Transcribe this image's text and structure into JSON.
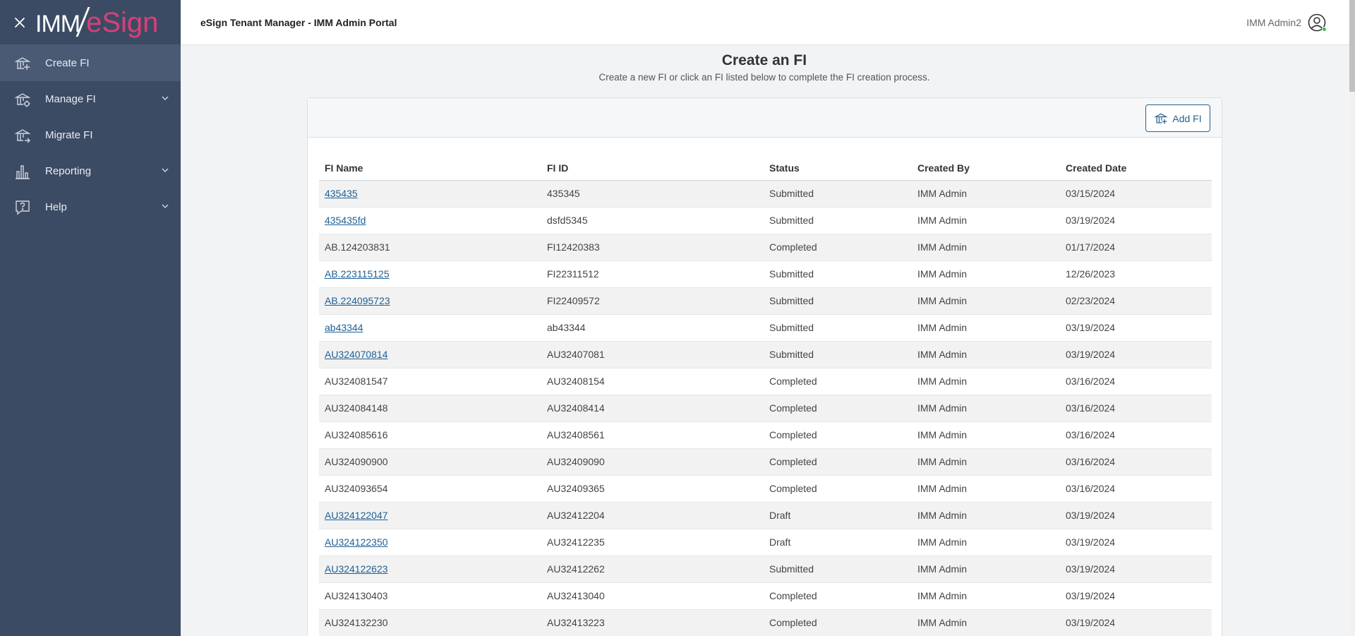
{
  "sidebar": {
    "logo": {
      "left": "IMM",
      "right": "eSign"
    },
    "items": [
      {
        "label": "Create FI",
        "icon": "bank-add-icon",
        "active": true,
        "expandable": false
      },
      {
        "label": "Manage FI",
        "icon": "bank-gear-icon",
        "active": false,
        "expandable": true
      },
      {
        "label": "Migrate FI",
        "icon": "bank-arrow-icon",
        "active": false,
        "expandable": false
      },
      {
        "label": "Reporting",
        "icon": "bar-chart-icon",
        "active": false,
        "expandable": true
      },
      {
        "label": "Help",
        "icon": "help-icon",
        "active": false,
        "expandable": true
      }
    ]
  },
  "topbar": {
    "title": "eSign Tenant Manager - IMM Admin Portal",
    "user_name": "IMM Admin2"
  },
  "main": {
    "title": "Create an FI",
    "subtitle": "Create a new FI or click an FI listed below to complete the FI creation process.",
    "add_button_label": "Add FI"
  },
  "table": {
    "columns": [
      "FI Name",
      "FI ID",
      "Status",
      "Created By",
      "Created Date"
    ],
    "rows": [
      {
        "name": "435435",
        "id": "435345",
        "status": "Submitted",
        "by": "IMM Admin",
        "date": "03/15/2024",
        "link": true
      },
      {
        "name": "435435fd",
        "id": "dsfd5345",
        "status": "Submitted",
        "by": "IMM Admin",
        "date": "03/19/2024",
        "link": true
      },
      {
        "name": "AB.124203831",
        "id": "FI12420383",
        "status": "Completed",
        "by": "IMM Admin",
        "date": "01/17/2024",
        "link": false
      },
      {
        "name": "AB.223115125",
        "id": "FI22311512",
        "status": "Submitted",
        "by": "IMM Admin",
        "date": "12/26/2023",
        "link": true
      },
      {
        "name": "AB.224095723",
        "id": "FI22409572",
        "status": "Submitted",
        "by": "IMM Admin",
        "date": "02/23/2024",
        "link": true
      },
      {
        "name": "ab43344",
        "id": "ab43344",
        "status": "Submitted",
        "by": "IMM Admin",
        "date": "03/19/2024",
        "link": true
      },
      {
        "name": "AU324070814",
        "id": "AU32407081",
        "status": "Submitted",
        "by": "IMM Admin",
        "date": "03/19/2024",
        "link": true
      },
      {
        "name": "AU324081547",
        "id": "AU32408154",
        "status": "Completed",
        "by": "IMM Admin",
        "date": "03/16/2024",
        "link": false
      },
      {
        "name": "AU324084148",
        "id": "AU32408414",
        "status": "Completed",
        "by": "IMM Admin",
        "date": "03/16/2024",
        "link": false
      },
      {
        "name": "AU324085616",
        "id": "AU32408561",
        "status": "Completed",
        "by": "IMM Admin",
        "date": "03/16/2024",
        "link": false
      },
      {
        "name": "AU324090900",
        "id": "AU32409090",
        "status": "Completed",
        "by": "IMM Admin",
        "date": "03/16/2024",
        "link": false
      },
      {
        "name": "AU324093654",
        "id": "AU32409365",
        "status": "Completed",
        "by": "IMM Admin",
        "date": "03/16/2024",
        "link": false
      },
      {
        "name": "AU324122047",
        "id": "AU32412204",
        "status": "Draft",
        "by": "IMM Admin",
        "date": "03/19/2024",
        "link": true
      },
      {
        "name": "AU324122350",
        "id": "AU32412235",
        "status": "Draft",
        "by": "IMM Admin",
        "date": "03/19/2024",
        "link": true
      },
      {
        "name": "AU324122623",
        "id": "AU32412262",
        "status": "Submitted",
        "by": "IMM Admin",
        "date": "03/19/2024",
        "link": true
      },
      {
        "name": "AU324130403",
        "id": "AU32413040",
        "status": "Completed",
        "by": "IMM Admin",
        "date": "03/19/2024",
        "link": false
      },
      {
        "name": "AU324132230",
        "id": "AU32413223",
        "status": "Completed",
        "by": "IMM Admin",
        "date": "03/19/2024",
        "link": false
      }
    ]
  },
  "colors": {
    "sidebar_bg": "#3c4b64",
    "sidebar_active": "#4a5a75",
    "link": "#1f5f95",
    "brand_pink": "#d93f79",
    "button_border": "#27628f"
  }
}
